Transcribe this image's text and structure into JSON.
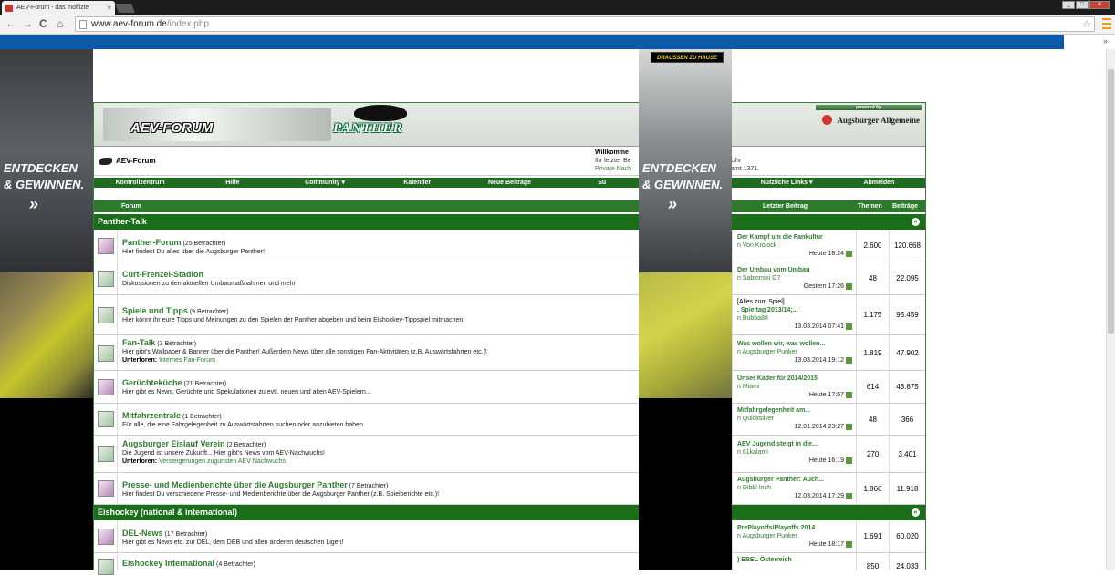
{
  "browser": {
    "tab_title": "AEV-Forum - das inoffizie",
    "tab_close": "×",
    "back": "←",
    "forward": "→",
    "reload": "C",
    "home": "⌂",
    "url_domain": "www.aev-forum.de",
    "url_path": "/index.php",
    "chevron": "»",
    "window_buttons": [
      "_",
      "□",
      "✕"
    ]
  },
  "ads": {
    "left_text1": "ENTDECKEN",
    "left_text2": "& GEWINNEN.",
    "arrow": "»",
    "right_tag": "DRAUSSEN ZU HAUSE",
    "right_text1": "ENTDECKEN",
    "right_text2": "& GEWINNEN."
  },
  "header": {
    "logo_text": "AEV-FORUM",
    "panther_text": "PANTHER",
    "powered_by": "powered by",
    "sponsor": "Augsburger Allgemeine"
  },
  "breadcrumb": {
    "home": "AEV-Forum",
    "welcome_title": "Willkomme",
    "welcome_line2": "Ihr letzter Be",
    "welcome_line3": "Private Nach",
    "welcome_right1": "Uhr",
    "welcome_right2": "amt 1371."
  },
  "navbar": [
    "Kontrollzentrum",
    "Hilfe",
    "Community ▾",
    "Kalender",
    "Neue Beiträge",
    "Su",
    "",
    "Nützliche Links ▾",
    "Abmelden"
  ],
  "table_head": {
    "forum": "Forum",
    "last_post": "Letzter Beitrag",
    "threads": "Themen",
    "posts": "Beiträge"
  },
  "categories": [
    {
      "name": "Panther-Talk",
      "collapse": "«"
    },
    {
      "name": "Eishockey (national & international)",
      "collapse": "«"
    }
  ],
  "forums": [
    {
      "title": "Panther-Forum",
      "viewers": "(25 Betrachter)",
      "desc": "Hier findest Du alles über die Augsburger Panther!",
      "sub_label": "",
      "sub": "",
      "last_title": "Der Kampf um die Fankultur",
      "last_by": "n Von Krolock",
      "last_date": "Heute 18:24",
      "threads": "2.600",
      "posts": "120.668"
    },
    {
      "title": "Curt-Frenzel-Stadion",
      "viewers": "",
      "desc": "Diskussionen zu den aktuellen Umbaumaßnahmen und mehr",
      "sub_label": "",
      "sub": "",
      "last_title": "Der Umbau vom Umbau",
      "last_by": "n Sabionski G7",
      "last_date": "Gestern 17:26",
      "threads": "48",
      "posts": "22.095"
    },
    {
      "title": "Spiele und Tipps",
      "viewers": "(9 Betrachter)",
      "desc": "Hier könnt ihr eure Tipps und Meinungen zu den Spielen der Panther abgeben und beim Eishockey-Tippspiel mitmachen.",
      "sub_label": "",
      "sub": "",
      "last_title": "[Alles zum Spiel]",
      "last_title2": ". Spieltag 2013/14;...",
      "last_by": "n Bubba88",
      "last_date": "13.03.2014 07:41",
      "threads": "1.175",
      "posts": "95.459"
    },
    {
      "title": "Fan-Talk",
      "viewers": "(3 Betrachter)",
      "desc": "Hier gibt's Wallpaper & Banner über die Panther! Außerdem News über alle sonstigen Fan-Aktivitäten (z.B. Auswärtsfahrten etc.)!",
      "sub_label": "Unterforen:",
      "sub": "Internes Fan-Forum",
      "last_title": "Was wollen wir, was wollen...",
      "last_by": "n Augsburger Punker",
      "last_date": "13.03.2014 19:12",
      "threads": "1.819",
      "posts": "47.902"
    },
    {
      "title": "Gerüchteküche",
      "viewers": "(21 Betrachter)",
      "desc": "Hier gibt es News, Gerüchte und Spekulationen zu evtl. neuen und alten AEV-Spielern...",
      "sub_label": "",
      "sub": "",
      "last_title": "Unser Kader für 2014/2015",
      "last_by": "n Miami",
      "last_date": "Heute 17:57",
      "threads": "614",
      "posts": "48.875"
    },
    {
      "title": "Mitfahrzentrale",
      "viewers": "(1 Betrachter)",
      "desc": "Für alle, die eine Fahrgelegenheit zu Auswärtsfahrten suchen oder anzubieten haben.",
      "sub_label": "",
      "sub": "",
      "last_title": "Mitfahrgelegenheit am...",
      "last_by": "n Quicksilver",
      "last_date": "12.01.2014 23:27",
      "threads": "48",
      "posts": "366"
    },
    {
      "title": "Augsburger Eislauf Verein",
      "viewers": "(2 Betrachter)",
      "desc": "Die Jugend ist unsere Zukunft... Hier gibt's News vom AEV-Nachwuchs!",
      "sub_label": "Unterforen:",
      "sub": "Versteigerungen zugunsten AEV Nachwuchs",
      "last_title": "AEV Jugend steigt in die...",
      "last_by": "n 61kalami",
      "last_date": "Heute 16:19",
      "threads": "270",
      "posts": "3.401"
    },
    {
      "title": "Presse- und Medienberichte über die Augsburger Panther",
      "viewers": "(7 Betrachter)",
      "desc": "Hier findest Du verschiedene Presse- und Medienberichte über die Augsburger Panther (z.B. Spielberichte etc.)!",
      "sub_label": "",
      "sub": "",
      "last_title": "Augsburger Panther: Auch...",
      "last_by": "n Dibbl Inch",
      "last_date": "12.03.2014 17:29",
      "threads": "1.866",
      "posts": "11.918"
    },
    {
      "title": "DEL-News",
      "viewers": "(17 Betrachter)",
      "desc": "Hier gibt es News etc. zur DEL, dem DEB und allen anderen deutschen Ligen!",
      "sub_label": "",
      "sub": "",
      "last_title": "PrePlayoffs/Playoffs 2014",
      "last_by": "n Augsburger Punker",
      "last_date": "Heute 18:17",
      "threads": "1.691",
      "posts": "60.020"
    },
    {
      "title": "Eishockey International",
      "viewers": "(4 Betrachter)",
      "desc": "",
      "sub_label": "",
      "sub": "",
      "last_title": ") EBEL Österreich",
      "last_by": "",
      "last_date": "",
      "threads": "850",
      "posts": "24.033"
    }
  ]
}
